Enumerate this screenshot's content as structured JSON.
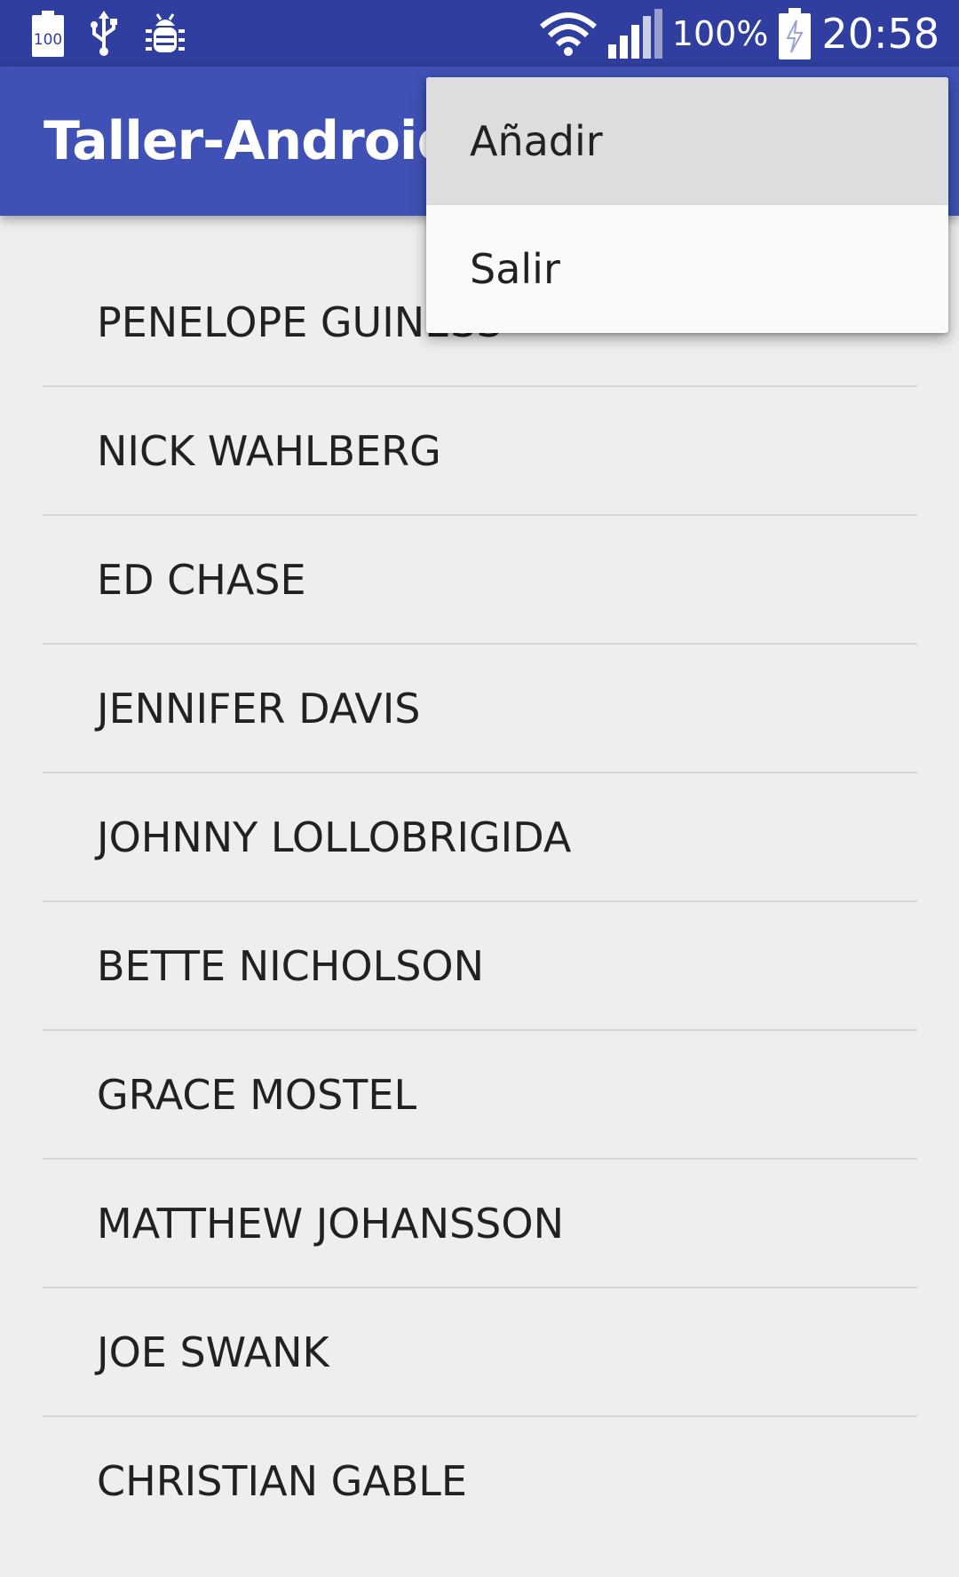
{
  "status_bar": {
    "left_icons": [
      "battery-100-icon",
      "usb-icon",
      "android-debug-icon"
    ],
    "battery_badge": "100",
    "battery_percent": "100%",
    "time": "20:58",
    "right_icons": [
      "wifi-icon",
      "signal-icon",
      "battery-charging-icon"
    ]
  },
  "app_bar": {
    "title": "Taller-Android-B"
  },
  "list": {
    "items": [
      {
        "label": "PENELOPE GUINESS"
      },
      {
        "label": "NICK WAHLBERG"
      },
      {
        "label": "ED CHASE"
      },
      {
        "label": "JENNIFER DAVIS"
      },
      {
        "label": "JOHNNY LOLLOBRIGIDA"
      },
      {
        "label": "BETTE NICHOLSON"
      },
      {
        "label": "GRACE MOSTEL"
      },
      {
        "label": "MATTHEW JOHANSSON"
      },
      {
        "label": "JOE SWANK"
      },
      {
        "label": "CHRISTIAN GABLE"
      }
    ]
  },
  "overflow_menu": {
    "items": [
      {
        "label": "Añadir"
      },
      {
        "label": "Salir"
      }
    ]
  },
  "colors": {
    "status_bar": "#303f9f",
    "app_bar": "#3f51b5",
    "background": "#eeeeee",
    "menu_highlight": "#dddddd",
    "menu_background": "#fafafa"
  }
}
